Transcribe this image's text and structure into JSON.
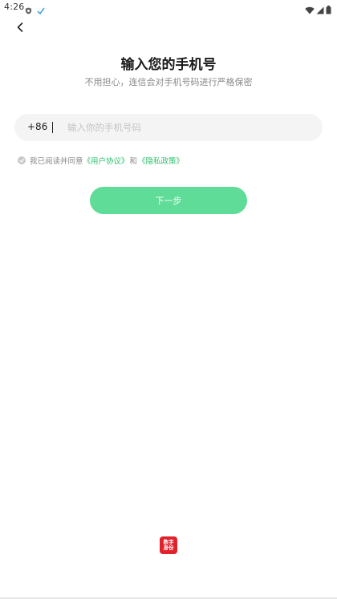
{
  "status_bar": {
    "time": "4:26"
  },
  "header": {
    "title": "输入您的手机号",
    "subtitle": "不用担心，连信会对手机号码进行严格保密"
  },
  "phone": {
    "country_code": "+86",
    "placeholder": "输入你的手机号码",
    "value": ""
  },
  "agreement": {
    "prefix": "我已阅读并同意",
    "user_agreement": "《用户协议》",
    "conjunction": "和",
    "privacy_policy": "《隐私政策》",
    "checked": false
  },
  "next_button": {
    "label": "下一步"
  },
  "logo": {
    "line1": "数字",
    "line2": "身份"
  },
  "colors": {
    "accent": "#2bbf6a",
    "button": "#5fdc97",
    "logo_bg": "#e0222a"
  }
}
